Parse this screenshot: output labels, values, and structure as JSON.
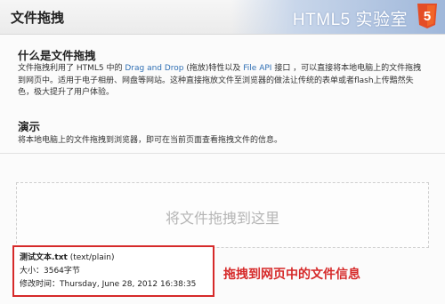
{
  "header": {
    "title": "文件拖拽",
    "banner_text": "HTML5 实验室",
    "logo_number": "5",
    "colors": {
      "logo_orange": "#e44d26",
      "accent_red": "#d62a2a",
      "link_blue": "#2f6fb4"
    }
  },
  "section_what": {
    "heading": "什么是文件拖拽",
    "text_1": "文件拖拽利用了 HTML5 中的 ",
    "link_1": "Drag and Drop",
    "text_2": " (拖放)特性以及 ",
    "link_2": "File API",
    "text_3": " 接口 ，可以直接将本地电脑上的文件拖拽到网页中。适用于电子相册、网盘等网站。这种直接拖放文件至浏览器的做法让传统的表单或者flash上传黯然失色，极大提升了用户体验。"
  },
  "section_demo": {
    "heading": "演示",
    "text": "将本地电脑上的文件拖拽到浏览器，即可在当前页面查看拖拽文件的信息。"
  },
  "dropzone": {
    "label": "将文件拖拽到这里"
  },
  "file_info": {
    "name": "测试文本.txt",
    "type": " (text/plain)",
    "size": "大小：3564字节",
    "modified": "修改时间：Thursday, June 28, 2012 16:38:35"
  },
  "callout": {
    "label": "拖拽到网页中的文件信息"
  }
}
